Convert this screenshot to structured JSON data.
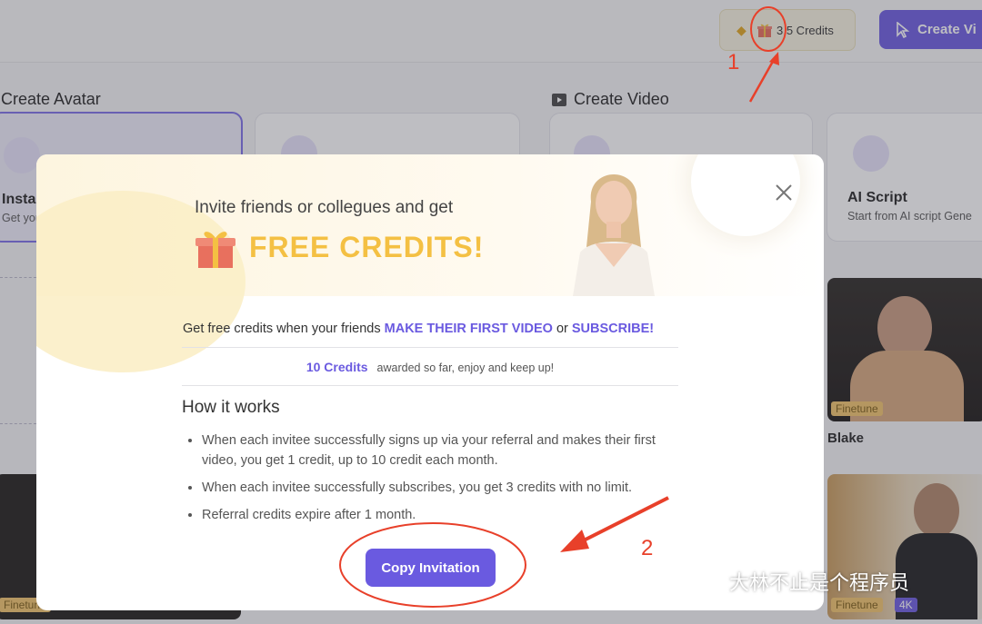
{
  "header": {
    "credits_label": "3.5 Credits",
    "create_label": "Create Vi"
  },
  "sections": {
    "avatar_title": "Create Avatar",
    "video_title": "Create Video"
  },
  "cards": {
    "instant_title": "Instar",
    "instant_sub": "Get you",
    "ai_script_title": "AI Script",
    "ai_script_sub": "Start from AI script Gene"
  },
  "thumbs": {
    "tag_finetune": "Finetune",
    "tag_4k": "4K",
    "presenter_name": "Blake"
  },
  "modal": {
    "invite_text": "Invite friends or collegues and get",
    "free_credits": "FREE CREDITS!",
    "line_prefix": "Get free credits when your friends ",
    "line_hl1": "MAKE THEIR FIRST VIDEO",
    "line_mid": " or ",
    "line_hl2": "SUBSCRIBE!",
    "awarded_num": "10 Credits",
    "awarded_text": "awarded so far, enjoy and keep up!",
    "how_title": "How it works",
    "bullets": [
      "When each invitee successfully signs up via your referral and makes their first video, you get 1 credit, up to 10 credit each month.",
      "When each invitee successfully subscribes, you get 3 credits with no limit.",
      "Referral credits expire after 1 month."
    ],
    "copy_button": "Copy Invitation"
  },
  "annotations": {
    "step1": "1",
    "step2": "2",
    "color": "#e8402a"
  },
  "watermark": {
    "text": "大林不止是个程序员"
  },
  "colors": {
    "accent": "#6a5ae0",
    "gold": "#f4c043"
  }
}
